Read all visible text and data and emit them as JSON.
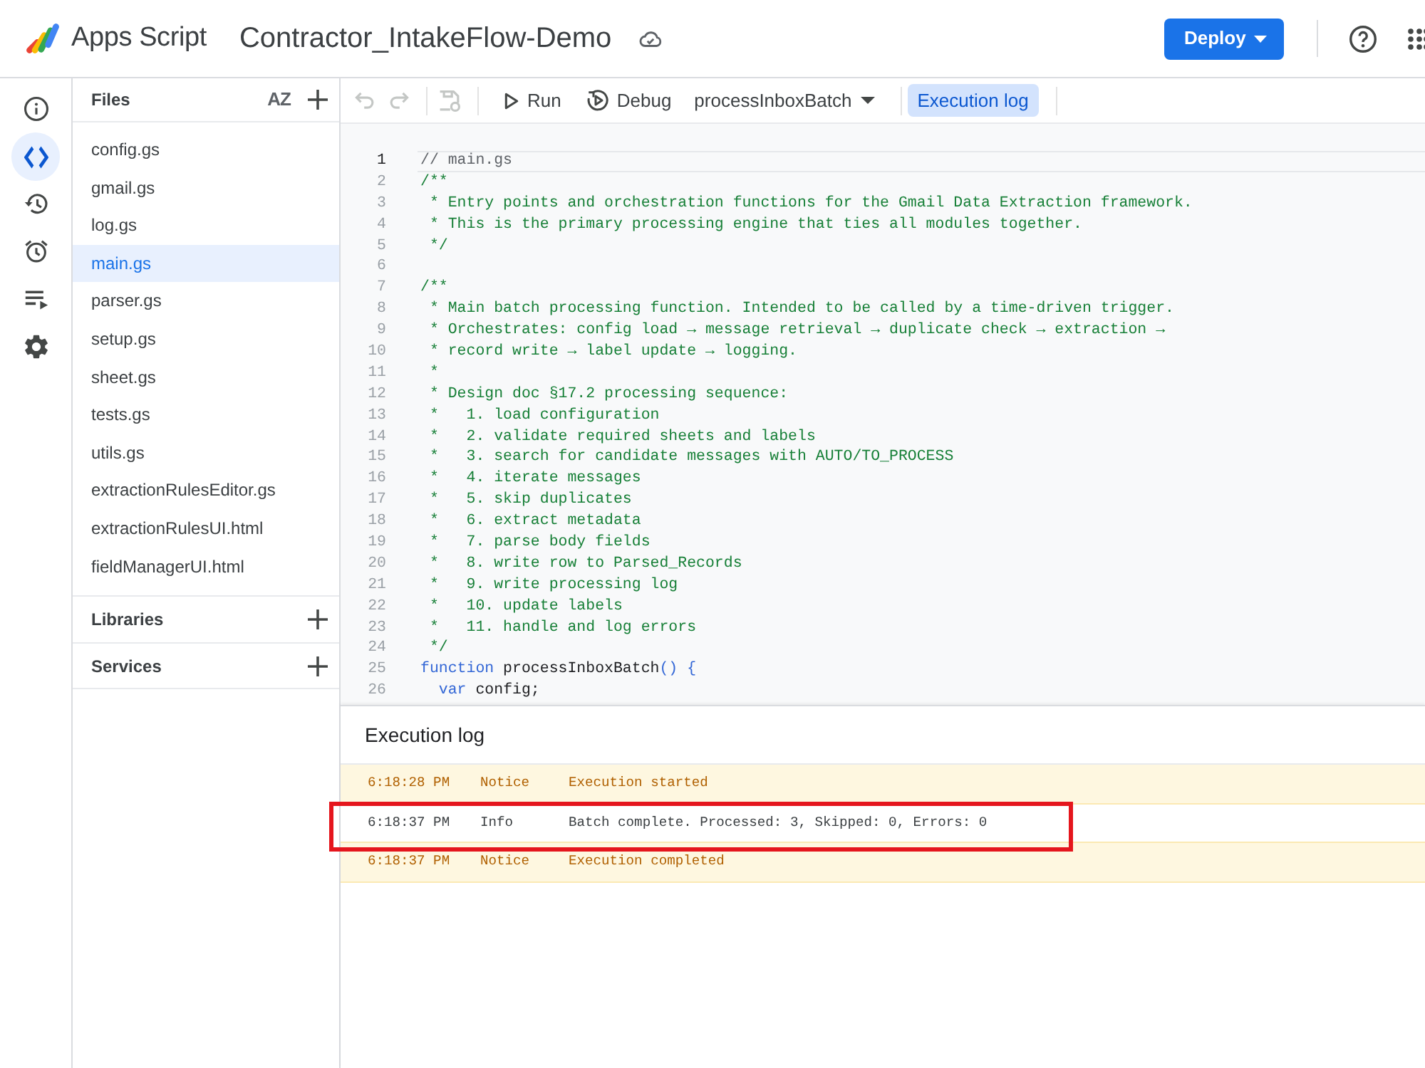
{
  "header": {
    "app_name": "Apps Script",
    "project_title": "Contractor_IntakeFlow-Demo",
    "deploy": "Deploy"
  },
  "rail": [
    {
      "kind": "info",
      "selected": false
    },
    {
      "kind": "code",
      "selected": true
    },
    {
      "kind": "history",
      "selected": false
    },
    {
      "kind": "triggers",
      "selected": false
    },
    {
      "kind": "executions",
      "selected": false
    },
    {
      "kind": "settings",
      "selected": false
    }
  ],
  "files": {
    "title": "Files",
    "sort": "AZ",
    "items": [
      {
        "name": "config.gs",
        "selected": false
      },
      {
        "name": "gmail.gs",
        "selected": false
      },
      {
        "name": "log.gs",
        "selected": false
      },
      {
        "name": "main.gs",
        "selected": true
      },
      {
        "name": "parser.gs",
        "selected": false
      },
      {
        "name": "setup.gs",
        "selected": false
      },
      {
        "name": "sheet.gs",
        "selected": false
      },
      {
        "name": "tests.gs",
        "selected": false
      },
      {
        "name": "utils.gs",
        "selected": false
      },
      {
        "name": "extractionRulesEditor.gs",
        "selected": false
      },
      {
        "name": "extractionRulesUI.html",
        "selected": false
      },
      {
        "name": "fieldManagerUI.html",
        "selected": false
      }
    ]
  },
  "sections": [
    {
      "title": "Libraries"
    },
    {
      "title": "Services"
    }
  ],
  "toolbar": {
    "icon_groups": [
      [
        {
          "kind": "undo",
          "disabled": true
        },
        {
          "kind": "redo",
          "disabled": true
        }
      ],
      [
        {
          "kind": "save",
          "disabled": true
        }
      ]
    ],
    "run": "Run",
    "debug": "Debug",
    "function": "processInboxBatch",
    "log_toggle": {
      "label": "Execution log",
      "selected": true
    }
  },
  "editor": {
    "lines": [
      {
        "number": "1",
        "current": true,
        "tokens": [
          {
            "kind": "comment",
            "text": "// main.gs"
          }
        ]
      },
      {
        "number": "2",
        "current": false,
        "tokens": [
          {
            "kind": "doc",
            "text": "/**"
          }
        ]
      },
      {
        "number": "3",
        "current": false,
        "tokens": [
          {
            "kind": "doc",
            "text": " * Entry points and orchestration functions for the Gmail Data Extraction framework."
          }
        ]
      },
      {
        "number": "4",
        "current": false,
        "tokens": [
          {
            "kind": "doc",
            "text": " * This is the primary processing engine that ties all modules together."
          }
        ]
      },
      {
        "number": "5",
        "current": false,
        "tokens": [
          {
            "kind": "doc",
            "text": " */"
          }
        ]
      },
      {
        "number": "6",
        "current": false
      },
      {
        "number": "7",
        "current": false,
        "tokens": [
          {
            "kind": "doc",
            "text": "/**"
          }
        ]
      },
      {
        "number": "8",
        "current": false,
        "tokens": [
          {
            "kind": "doc",
            "text": " * Main batch processing function. Intended to be called by a time-driven trigger."
          }
        ]
      },
      {
        "number": "9",
        "current": false,
        "tokens": [
          {
            "kind": "doc",
            "text": " * Orchestrates: config load → message retrieval → duplicate check → extraction →"
          }
        ]
      },
      {
        "number": "10",
        "current": false,
        "tokens": [
          {
            "kind": "doc",
            "text": " * record write → label update → logging."
          }
        ]
      },
      {
        "number": "11",
        "current": false,
        "tokens": [
          {
            "kind": "doc",
            "text": " *"
          }
        ]
      },
      {
        "number": "12",
        "current": false,
        "tokens": [
          {
            "kind": "doc",
            "text": " * Design doc §17.2 processing sequence:"
          }
        ]
      },
      {
        "number": "13",
        "current": false,
        "tokens": [
          {
            "kind": "doc",
            "text": " *   1. load configuration"
          }
        ]
      },
      {
        "number": "14",
        "current": false,
        "tokens": [
          {
            "kind": "doc",
            "text": " *   2. validate required sheets and labels"
          }
        ]
      },
      {
        "number": "15",
        "current": false,
        "tokens": [
          {
            "kind": "doc",
            "text": " *   3. search for candidate messages with AUTO/TO_PROCESS"
          }
        ]
      },
      {
        "number": "16",
        "current": false,
        "tokens": [
          {
            "kind": "doc",
            "text": " *   4. iterate messages"
          }
        ]
      },
      {
        "number": "17",
        "current": false,
        "tokens": [
          {
            "kind": "doc",
            "text": " *   5. skip duplicates"
          }
        ]
      },
      {
        "number": "18",
        "current": false,
        "tokens": [
          {
            "kind": "doc",
            "text": " *   6. extract metadata"
          }
        ]
      },
      {
        "number": "19",
        "current": false,
        "tokens": [
          {
            "kind": "doc",
            "text": " *   7. parse body fields"
          }
        ]
      },
      {
        "number": "20",
        "current": false,
        "tokens": [
          {
            "kind": "doc",
            "text": " *   8. write row to Parsed_Records"
          }
        ]
      },
      {
        "number": "21",
        "current": false,
        "tokens": [
          {
            "kind": "doc",
            "text": " *   9. write processing log"
          }
        ]
      },
      {
        "number": "22",
        "current": false,
        "tokens": [
          {
            "kind": "doc",
            "text": " *   10. update labels"
          }
        ]
      },
      {
        "number": "23",
        "current": false,
        "tokens": [
          {
            "kind": "doc",
            "text": " *   11. handle and log errors"
          }
        ]
      },
      {
        "number": "24",
        "current": false,
        "tokens": [
          {
            "kind": "doc",
            "text": " */"
          }
        ]
      },
      {
        "number": "25",
        "current": false,
        "tokens": [
          {
            "kind": "keyword",
            "text": "function"
          },
          {
            "kind": "plain",
            "text": " processInboxBatch"
          },
          {
            "kind": "bracket",
            "text": "() {"
          }
        ]
      },
      {
        "number": "26",
        "current": false,
        "tokens": [
          {
            "kind": "keyword",
            "text": "  var"
          },
          {
            "kind": "plain",
            "text": " config;"
          }
        ]
      }
    ]
  },
  "execution_log": {
    "title": "Execution log",
    "rows": [
      {
        "kind": "notice",
        "time": "6:18:28 PM",
        "level": "Notice",
        "message": "Execution started",
        "highlighted": false
      },
      {
        "kind": "info",
        "time": "6:18:37 PM",
        "level": "Info",
        "message": "Batch complete. Processed: 3, Skipped: 0, Errors: 0",
        "highlighted": true
      },
      {
        "kind": "notice",
        "time": "6:18:37 PM",
        "level": "Notice",
        "message": "Execution completed",
        "highlighted": false
      }
    ]
  }
}
